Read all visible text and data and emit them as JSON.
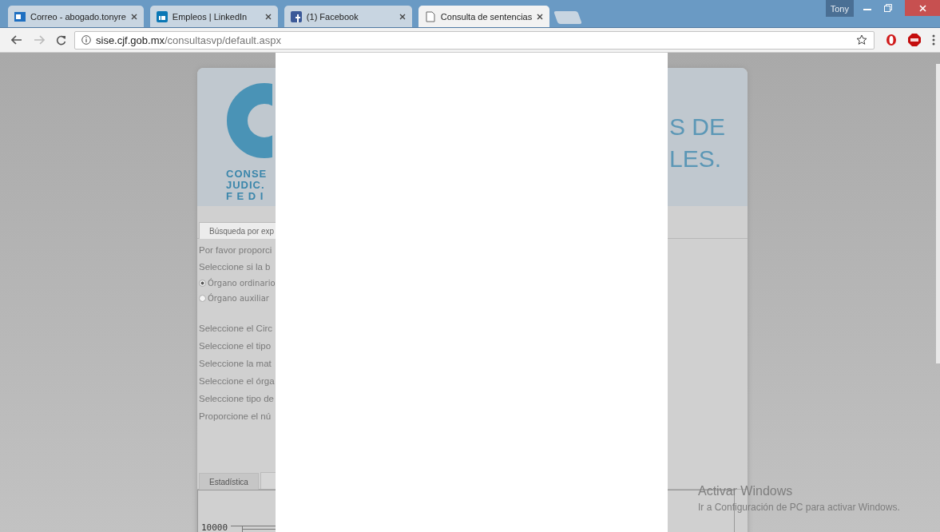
{
  "browser": {
    "tabs": [
      {
        "title": "Correo - abogado.tonyre",
        "kind": "mail",
        "selected": false
      },
      {
        "title": "Empleos | LinkedIn",
        "kind": "network",
        "selected": false
      },
      {
        "title": "(1) Facebook",
        "kind": "social",
        "selected": false
      },
      {
        "title": "Consulta de sentencias",
        "kind": "page",
        "selected": true
      }
    ],
    "profile": "Tony",
    "url": {
      "host": "sise.cjf.gob.mx",
      "path": "/consultasvp/default.aspx"
    },
    "forward_disabled": true
  },
  "page": {
    "logo_lines": [
      "CONSE",
      "JUDIC.",
      "F E D I"
    ],
    "title_lines": [
      "S DE",
      "LES."
    ],
    "search_tab": {
      "label": "Búsqueda por exp",
      "selected": true
    },
    "intro": [
      "Por favor proporci",
      "Seleccione si la b"
    ],
    "radios": [
      {
        "label": "Órgano ordinario",
        "selected": true
      },
      {
        "label": "Órgano auxiliar",
        "selected": false
      }
    ],
    "prompts": [
      "Seleccione el Circ",
      "Seleccione el tipo",
      "Seleccione la mat",
      "Seleccione el órga",
      "Seleccione tipo de",
      "Proporcione el nú"
    ],
    "bottom_tab": {
      "label": "Estadística",
      "selected": false
    },
    "chart_tick": "10000"
  },
  "os_notice": {
    "title": "Activar Windows",
    "text": "Ir a Configuración de PC para activar Windows."
  }
}
